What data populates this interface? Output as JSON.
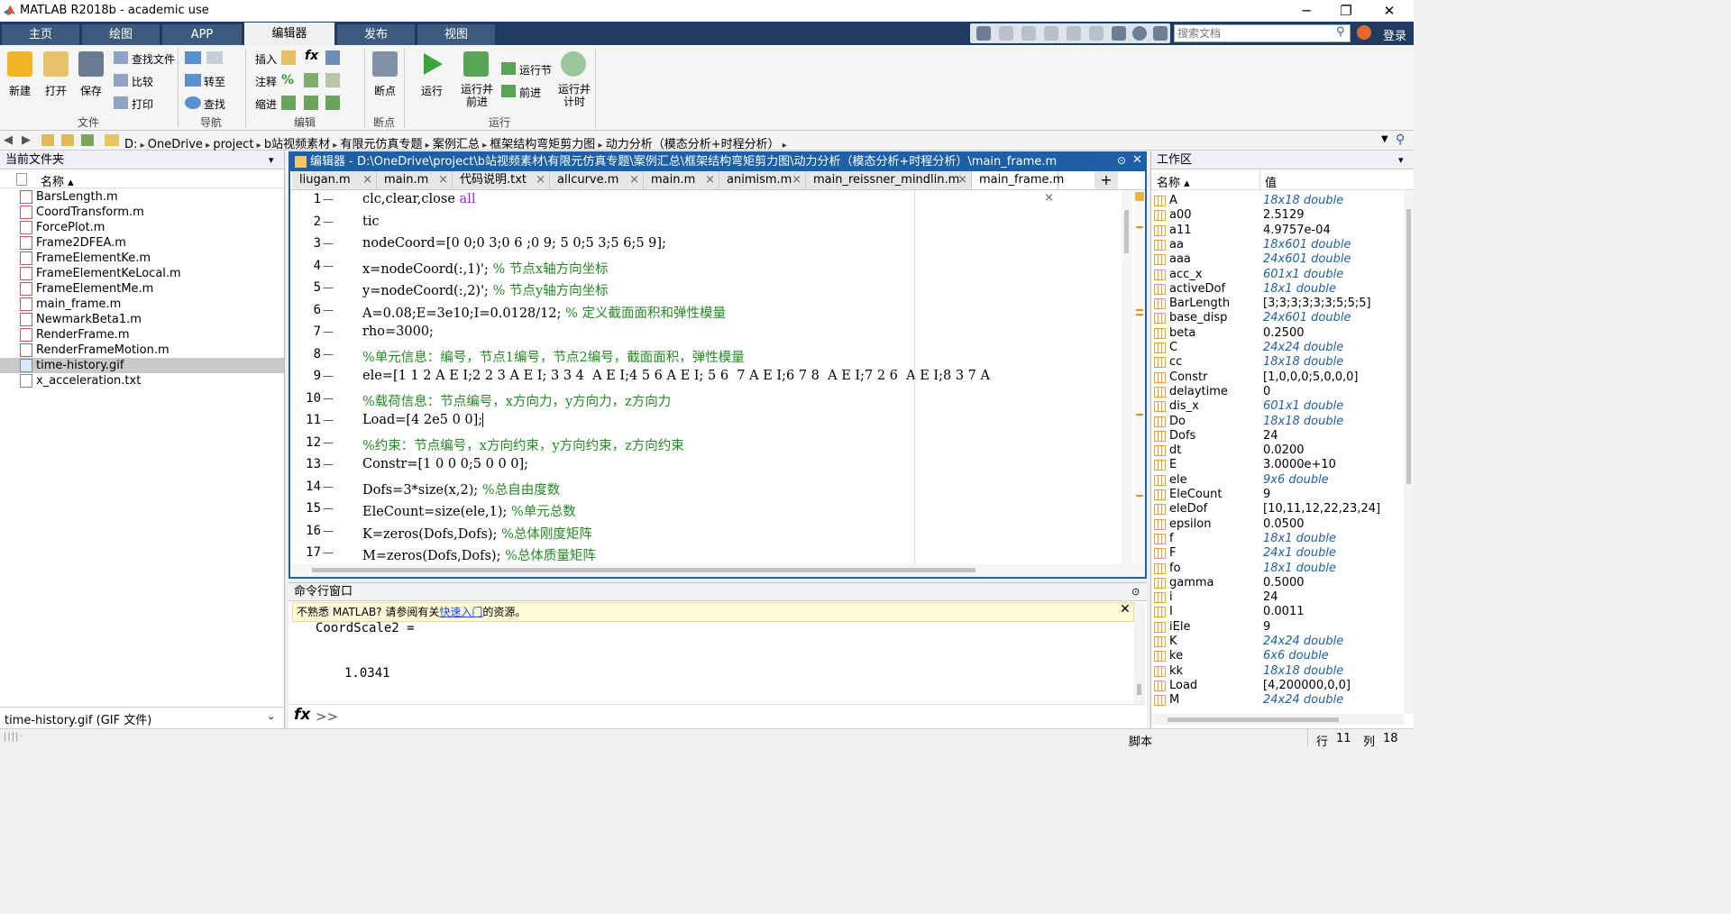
{
  "window": {
    "title": "MATLAB R2018b - academic use",
    "minimize": "─",
    "restore": "❐",
    "close": "✕"
  },
  "tabs": [
    "主页",
    "绘图",
    "APP",
    "编辑器",
    "发布",
    "视图"
  ],
  "search": {
    "placeholder": "搜索文档"
  },
  "login": "登录",
  "ribbon": {
    "file": {
      "new": "新建",
      "open": "打开",
      "save": "保存",
      "find_file": "查找文件",
      "compare": "比较",
      "print": "打印",
      "group": "文件"
    },
    "nav": {
      "goto": "转至",
      "find": "查找",
      "group": "导航"
    },
    "edit": {
      "insert": "插入",
      "comment": "注释",
      "indent": "缩进",
      "fx": "fx",
      "group": "编辑"
    },
    "breakpoints": {
      "label": "断点",
      "group": "断点"
    },
    "run": {
      "run": "运行",
      "run_advance": "运行并\n前进",
      "run_section": "运行节",
      "advance": "前进",
      "run_time": "运行并\n计时",
      "group": "运行"
    }
  },
  "address": {
    "path": [
      "D:",
      "OneDrive",
      "project",
      "b站视频素材",
      "有限元仿真专题",
      "案例汇总",
      "框架结构弯矩剪力图",
      "动力分析（模态分析+时程分析）"
    ]
  },
  "current_folder": {
    "title": "当前文件夹",
    "col": "名称 ▴",
    "files": [
      {
        "name": "BarsLength.m",
        "type": "m"
      },
      {
        "name": "CoordTransform.m",
        "type": "m"
      },
      {
        "name": "ForcePlot.m",
        "type": "m"
      },
      {
        "name": "Frame2DFEA.m",
        "type": "m"
      },
      {
        "name": "FrameElementKe.m",
        "type": "m"
      },
      {
        "name": "FrameElementKeLocal.m",
        "type": "m"
      },
      {
        "name": "FrameElementMe.m",
        "type": "m"
      },
      {
        "name": "main_frame.m",
        "type": "m"
      },
      {
        "name": "NewmarkBeta1.m",
        "type": "m"
      },
      {
        "name": "RenderFrame.m",
        "type": "m"
      },
      {
        "name": "RenderFrameMotion.m",
        "type": "m"
      },
      {
        "name": "time-history.gif",
        "type": "gif"
      },
      {
        "name": "x_acceleration.txt",
        "type": "txt"
      }
    ],
    "selected": "time-history.gif",
    "details": "time-history.gif (GIF 文件)"
  },
  "editor": {
    "title": "编辑器 - D:\\OneDrive\\project\\b站视频素材\\有限元仿真专题\\案例汇总\\框架结构弯矩剪力图\\动力分析（模态分析+时程分析）\\main_frame.m",
    "tabs": [
      "liugan.m",
      "main.m",
      "代码说明.txt",
      "allcurve.m",
      "main.m",
      "animism.m",
      "main_reissner_mindlin.m",
      "main_frame.m"
    ],
    "active_tab": "main_frame.m",
    "lines": [
      {
        "n": "1",
        "c": "clc,clear,close ",
        "k": "all",
        "m": ""
      },
      {
        "n": "2",
        "c": "tic",
        "k": "",
        "m": ""
      },
      {
        "n": "3",
        "c": "nodeCoord=[0 0;0 3;0 6 ;0 9; 5 0;5 3;5 6;5 9];",
        "k": "",
        "m": ""
      },
      {
        "n": "4",
        "c": "x=nodeCoord(:,1)'; ",
        "k": "",
        "m": "% 节点x轴方向坐标"
      },
      {
        "n": "5",
        "c": "y=nodeCoord(:,2)'; ",
        "k": "",
        "m": "% 节点y轴方向坐标"
      },
      {
        "n": "6",
        "c": "A=0.08;E=3e10;I=0.0128/12; ",
        "k": "",
        "m": "% 定义截面面积和弹性模量"
      },
      {
        "n": "7",
        "c": "rho=3000;",
        "k": "",
        "m": ""
      },
      {
        "n": "8",
        "c": "",
        "k": "",
        "m": "%单元信息：编号，节点1编号，节点2编号，截面面积，弹性模量"
      },
      {
        "n": "9",
        "c": "ele=[1 1 2 A E I;2 2 3 A E I; 3 3 4  A E I;4 5 6 A E I; 5 6  7 A E I;6 7 8  A E I;7 2 6  A E I;8 3 7 A",
        "k": "",
        "m": ""
      },
      {
        "n": "10",
        "c": "",
        "k": "",
        "m": "%载荷信息：节点编号，x方向力，y方向力，z方向力"
      },
      {
        "n": "11",
        "c": "Load=[4 2e5 0 0];",
        "k": "",
        "m": ""
      },
      {
        "n": "12",
        "c": "",
        "k": "",
        "m": "%约束：节点编号，x方向约束，y方向约束，z方向约束"
      },
      {
        "n": "13",
        "c": "Constr=[1 0 0 0;5 0 0 0];",
        "k": "",
        "m": ""
      },
      {
        "n": "14",
        "c": "Dofs=3*size(x,2); ",
        "k": "",
        "m": "%总自由度数"
      },
      {
        "n": "15",
        "c": "EleCount=size(ele,1); ",
        "k": "",
        "m": "%单元总数"
      },
      {
        "n": "16",
        "c": "K=zeros(Dofs,Dofs); ",
        "k": "",
        "m": "%总体刚度矩阵"
      },
      {
        "n": "17",
        "c": "M=zeros(Dofs,Dofs); ",
        "k": "",
        "m": "%总体质量矩阵"
      }
    ]
  },
  "command": {
    "title": "命令行窗口",
    "notice_pre": "不熟悉 MATLAB? 请参阅有关",
    "notice_link": "快速入门",
    "notice_post": "的资源。",
    "out_var": "CoordScale2 =",
    "out_val": "1.0341",
    "prompt": ">>",
    "fx": "fx"
  },
  "workspace": {
    "title": "工作区",
    "col_name": "名称 ▴",
    "col_value": "值",
    "vars": [
      {
        "name": "A",
        "value": "18x18 double",
        "it": true
      },
      {
        "name": "a00",
        "value": "2.5129",
        "it": false
      },
      {
        "name": "a11",
        "value": "4.9757e-04",
        "it": false
      },
      {
        "name": "aa",
        "value": "18x601 double",
        "it": true
      },
      {
        "name": "aaa",
        "value": "24x601 double",
        "it": true
      },
      {
        "name": "acc_x",
        "value": "601x1 double",
        "it": true
      },
      {
        "name": "activeDof",
        "value": "18x1 double",
        "it": true
      },
      {
        "name": "BarLength",
        "value": "[3;3;3;3;3;3;5;5;5]",
        "it": false
      },
      {
        "name": "base_disp",
        "value": "24x601 double",
        "it": true
      },
      {
        "name": "beta",
        "value": "0.2500",
        "it": false
      },
      {
        "name": "C",
        "value": "24x24 double",
        "it": true
      },
      {
        "name": "cc",
        "value": "18x18 double",
        "it": true
      },
      {
        "name": "Constr",
        "value": "[1,0,0,0;5,0,0,0]",
        "it": false
      },
      {
        "name": "delaytime",
        "value": "0",
        "it": false
      },
      {
        "name": "dis_x",
        "value": "601x1 double",
        "it": true
      },
      {
        "name": "Do",
        "value": "18x18 double",
        "it": true
      },
      {
        "name": "Dofs",
        "value": "24",
        "it": false
      },
      {
        "name": "dt",
        "value": "0.0200",
        "it": false
      },
      {
        "name": "E",
        "value": "3.0000e+10",
        "it": false
      },
      {
        "name": "ele",
        "value": "9x6 double",
        "it": true
      },
      {
        "name": "EleCount",
        "value": "9",
        "it": false
      },
      {
        "name": "eleDof",
        "value": "[10,11,12,22,23,24]",
        "it": false
      },
      {
        "name": "epsilon",
        "value": "0.0500",
        "it": false
      },
      {
        "name": "f",
        "value": "18x1 double",
        "it": true
      },
      {
        "name": "F",
        "value": "24x1 double",
        "it": true
      },
      {
        "name": "fo",
        "value": "18x1 double",
        "it": true
      },
      {
        "name": "gamma",
        "value": "0.5000",
        "it": false
      },
      {
        "name": "i",
        "value": "24",
        "it": false
      },
      {
        "name": "I",
        "value": "0.0011",
        "it": false
      },
      {
        "name": "iEle",
        "value": "9",
        "it": false
      },
      {
        "name": "K",
        "value": "24x24 double",
        "it": true
      },
      {
        "name": "ke",
        "value": "6x6 double",
        "it": true
      },
      {
        "name": "kk",
        "value": "18x18 double",
        "it": true
      },
      {
        "name": "Load",
        "value": "[4,200000,0,0]",
        "it": false
      },
      {
        "name": "M",
        "value": "24x24 double",
        "it": true
      }
    ]
  },
  "status": {
    "mode": "脚本",
    "row_label": "行",
    "row": "11",
    "col_label": "列",
    "col": "18"
  }
}
